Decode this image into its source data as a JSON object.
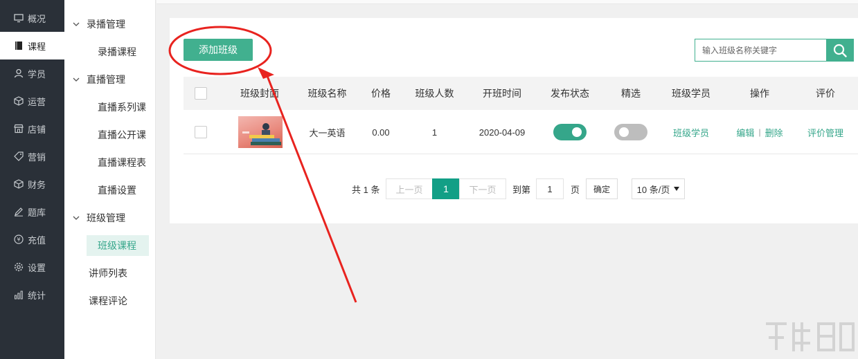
{
  "nav": {
    "items": [
      {
        "label": "概况",
        "icon": "monitor-icon"
      },
      {
        "label": "课程",
        "icon": "book-icon"
      },
      {
        "label": "学员",
        "icon": "user-icon"
      },
      {
        "label": "运营",
        "icon": "cube-icon"
      },
      {
        "label": "店铺",
        "icon": "store-icon"
      },
      {
        "label": "营销",
        "icon": "tag-icon"
      },
      {
        "label": "财务",
        "icon": "cube-icon"
      },
      {
        "label": "题库",
        "icon": "pencil-icon"
      },
      {
        "label": "充值",
        "icon": "yen-icon"
      },
      {
        "label": "设置",
        "icon": "gear-icon"
      },
      {
        "label": "统计",
        "icon": "bar-chart-icon"
      }
    ],
    "active": "课程"
  },
  "submenu": {
    "groups": [
      {
        "title": "录播管理",
        "items": [
          "录播课程"
        ]
      },
      {
        "title": "直播管理",
        "items": [
          "直播系列课",
          "直播公开课",
          "直播课程表",
          "直播设置"
        ]
      },
      {
        "title": "班级管理",
        "items": [
          "班级课程"
        ]
      }
    ],
    "extra": [
      "讲师列表",
      "课程评论"
    ],
    "active": "班级课程"
  },
  "toolbar": {
    "add_label": "添加班级",
    "search_placeholder": "输入班级名称关键字"
  },
  "table": {
    "headers": [
      "班级封面",
      "班级名称",
      "价格",
      "班级人数",
      "开班时间",
      "发布状态",
      "精选",
      "班级学员",
      "操作",
      "评价"
    ],
    "rows": [
      {
        "name": "大一英语",
        "price": "0.00",
        "count": "1",
        "start": "2020-04-09",
        "published": true,
        "featured": false,
        "students_link": "班级学员",
        "edit": "编辑",
        "delete": "删除",
        "review": "评价管理"
      }
    ]
  },
  "pager": {
    "total": "共 1 条",
    "prev": "上一页",
    "current": "1",
    "next": "下一页",
    "goto": "到第",
    "goto_value": "1",
    "page_unit": "页",
    "ok": "确定",
    "size": "10 条/页"
  },
  "colors": {
    "accent": "#41b08f",
    "nav_bg": "#2a3038",
    "annotation": "#e8231f"
  }
}
